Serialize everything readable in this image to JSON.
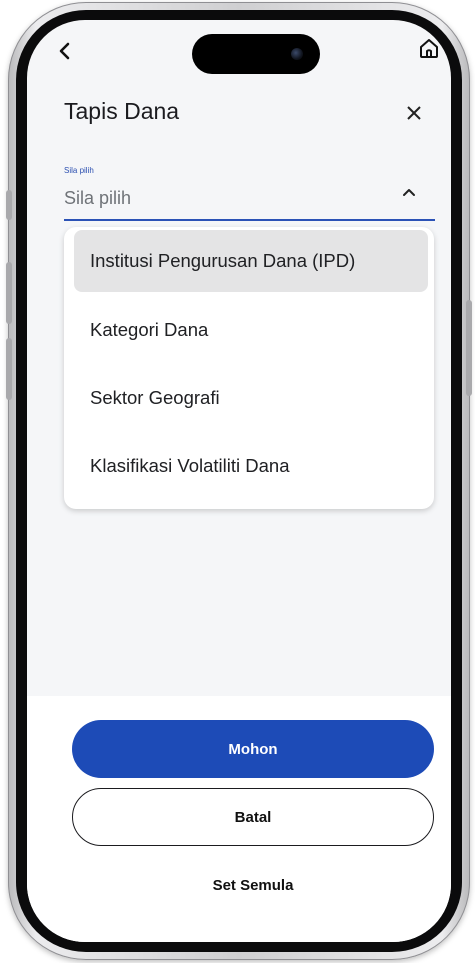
{
  "header": {
    "title": "Tapis Dana",
    "back_icon": "chevron-left-icon",
    "home_icon": "home-icon",
    "close_icon": "close-icon"
  },
  "select": {
    "label": "Sila pilih",
    "value": "Sila pilih",
    "expanded": true
  },
  "dropdown": {
    "options": [
      {
        "label": "Institusi Pengurusan Dana (IPD)",
        "selected": true
      },
      {
        "label": "Kategori Dana",
        "selected": false
      },
      {
        "label": "Sektor Geografi",
        "selected": false
      },
      {
        "label": "Klasifikasi Volatiliti Dana",
        "selected": false
      }
    ]
  },
  "actions": {
    "apply_label": "Mohon",
    "cancel_label": "Batal",
    "reset_label": "Set Semula"
  },
  "colors": {
    "primary": "#1d4bb7",
    "underline": "#2b52b6",
    "selected_option_bg": "#e4e4e5"
  }
}
